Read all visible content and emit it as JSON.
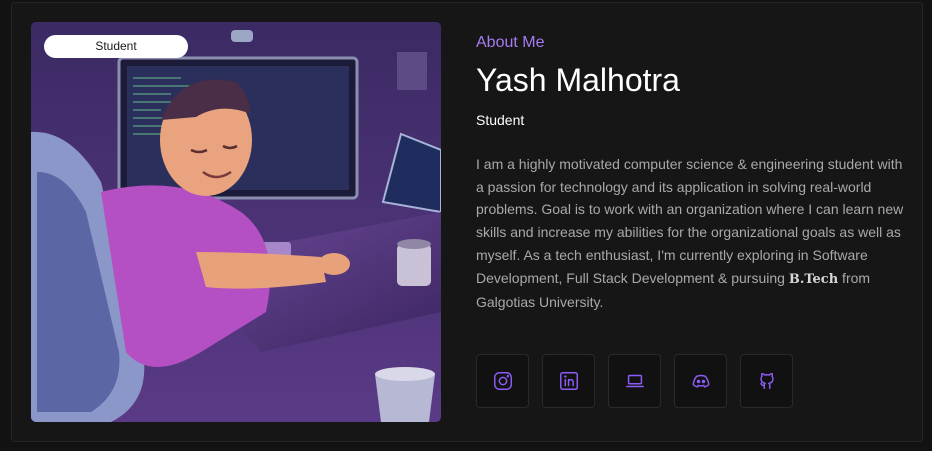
{
  "profile": {
    "badge": "Student",
    "eyebrow": "About Me",
    "name": "Yash Malhotra",
    "role": "Student",
    "bio_part1": "I am a highly motivated computer science & engineering student with a passion for technology and its application in solving real-world problems. Goal is to work with an organization where I can learn new skills and increase my abilities for the organizational goals as well as myself. As a tech enthusiast, I'm currently exploring in Software Development, Full Stack Development & pursuing ",
    "bio_degree": "B.Tech",
    "bio_part2": " from Galgotias University."
  },
  "socials": [
    {
      "icon": "instagram-icon"
    },
    {
      "icon": "linkedin-icon"
    },
    {
      "icon": "laptop-icon"
    },
    {
      "icon": "discord-icon"
    },
    {
      "icon": "github-icon"
    }
  ],
  "colors": {
    "accent": "#a77bf0",
    "icon": "#8b5cf6",
    "background": "#161616",
    "text": "#ffffff",
    "muted": "#a9a9a9"
  }
}
